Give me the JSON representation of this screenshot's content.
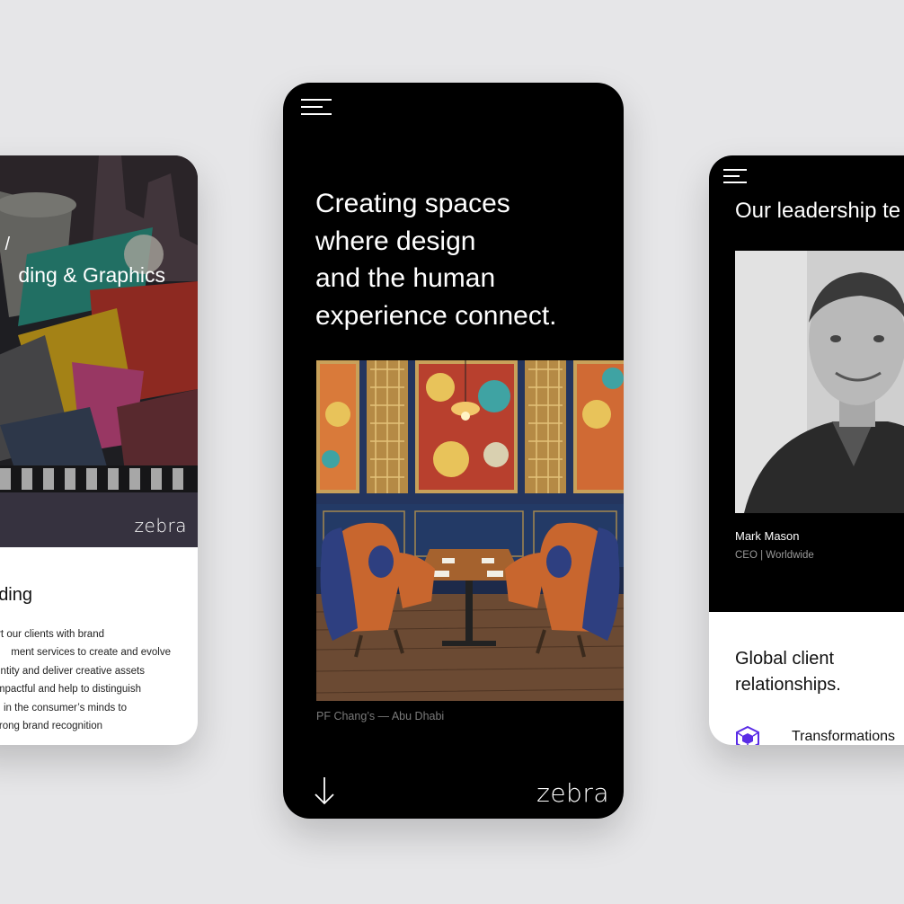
{
  "left_screen": {
    "breadcrumb": "s /",
    "title": "ding & Graphics",
    "logo": "zebra",
    "section_heading": "ding",
    "body_lines": [
      "ort our clients with brand",
      "ment services to create and evolve",
      "entity and deliver creative assets",
      "mpactful and help to distinguish",
      "d in the consumer’s minds to",
      "strong brand recognition"
    ]
  },
  "center_screen": {
    "menu_icon": "hamburger-menu-icon",
    "headline_lines": [
      "Creating spaces",
      "where design",
      "and the human",
      "experience connect."
    ],
    "photo_caption": "PF Chang’s — Abu Dhabi",
    "scroll_icon": "arrow-down-icon",
    "logo": "zebra"
  },
  "right_screen": {
    "menu_icon": "hamburger-menu-icon",
    "heading": "Our leadership te",
    "person_name": "Mark Mason",
    "person_role": "CEO | Worldwide",
    "global_title_lines": [
      "Global client",
      "relationships."
    ],
    "feature_icon": "cube-icon",
    "feature_label": "Transformations"
  },
  "colors": {
    "background": "#e6e6e8",
    "dark_screen": "#000000",
    "accent_purple": "#5a2ce6"
  }
}
